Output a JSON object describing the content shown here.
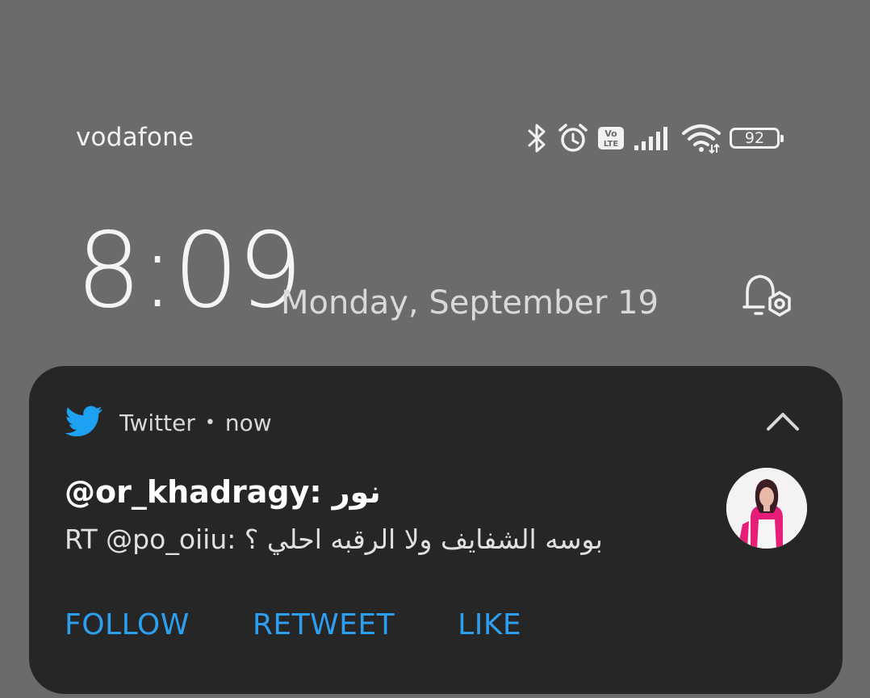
{
  "status_bar": {
    "carrier": "vodafone",
    "battery_percent": "92",
    "icons": [
      "bluetooth-icon",
      "alarm-icon",
      "volte-icon",
      "signal-icon",
      "wifi-icon",
      "battery-icon"
    ],
    "volte_top": "Vo",
    "volte_bottom": "LTE"
  },
  "lockscreen": {
    "time": "8:09",
    "date": "Monday, September 19",
    "settings_icon": "bell-settings-icon"
  },
  "notification": {
    "app_name": "Twitter",
    "separator": "•",
    "time": "now",
    "title": "@or_khadragy: نور",
    "body": "RT @po_oiiu: بوسه الشفايف ولا الرقبه احلي ؟",
    "actions": {
      "follow": "FOLLOW",
      "retweet": "RETWEET",
      "like": "LIKE"
    },
    "colors": {
      "accent": "#2d9ff0",
      "card_bg": "#262626",
      "twitter_blue": "#1da1f2"
    }
  }
}
